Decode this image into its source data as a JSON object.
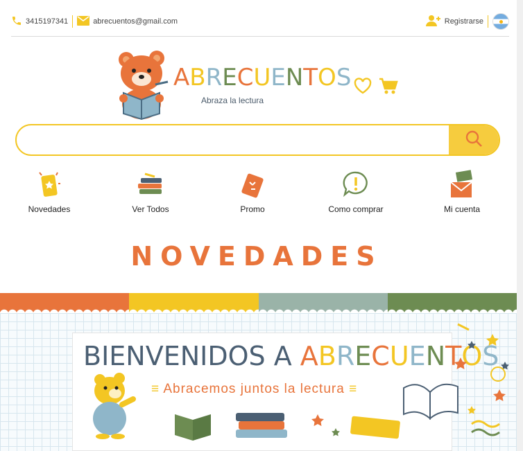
{
  "topbar": {
    "phone": "3415197341",
    "email": "abrecuentos@gmail.com",
    "register_label": "Registrarse"
  },
  "logo": {
    "title": "ABRECUENTOS",
    "subtitle": "Abraza la lectura"
  },
  "search": {
    "placeholder": "",
    "value": ""
  },
  "nav": {
    "items": [
      {
        "label": "Novedades",
        "icon": "news-icon"
      },
      {
        "label": "Ver Todos",
        "icon": "books-stack-icon"
      },
      {
        "label": "Promo",
        "icon": "promo-book-icon"
      },
      {
        "label": "Como comprar",
        "icon": "info-bubble-icon"
      },
      {
        "label": "Mi cuenta",
        "icon": "account-envelope-icon"
      }
    ]
  },
  "section": {
    "title": "NOVEDADES"
  },
  "banner": {
    "title_part1": "BIENVENIDOS A ",
    "title_part2": "ABRECUENTOS",
    "subtitle": "Abracemos juntos la lectura"
  },
  "colors": {
    "orange": "#e8743b",
    "yellow": "#f3c623",
    "blue_grey": "#8fb6c9",
    "green": "#6d8c52",
    "dark_slate": "#4b5f73"
  }
}
